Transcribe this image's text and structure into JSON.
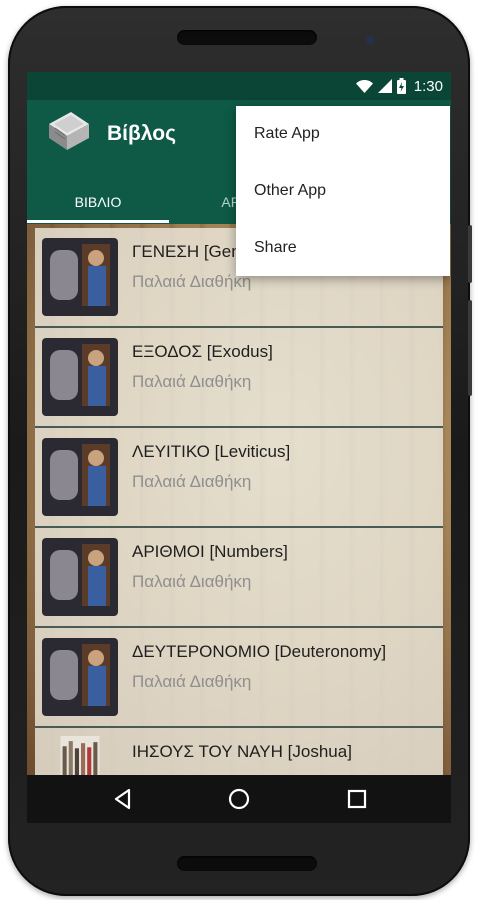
{
  "status": {
    "time": "1:30",
    "icons": [
      "wifi-icon",
      "cell-signal-icon",
      "battery-charging-icon"
    ]
  },
  "appbar": {
    "title": "Βίβλος",
    "logo": "bible-book-icon"
  },
  "tabs": [
    {
      "label": "ΒΙΒΛΙΟ",
      "active": true
    },
    {
      "label": "ΑΡΓΟ",
      "active": false
    }
  ],
  "menu": {
    "items": [
      {
        "label": "Rate App"
      },
      {
        "label": "Other App"
      },
      {
        "label": "Share"
      }
    ]
  },
  "books": [
    {
      "title": "ΓΕΝΕΣΗ [Genesis]",
      "subtitle": "Παλαιά Διαθήκη"
    },
    {
      "title": "ΕΞΟΔΟΣ [Exodus]",
      "subtitle": "Παλαιά Διαθήκη"
    },
    {
      "title": "ΛΕΥΙΤΙΚΟ [Leviticus]",
      "subtitle": "Παλαιά Διαθήκη"
    },
    {
      "title": "ΑΡΙΘΜΟΙ [Numbers]",
      "subtitle": "Παλαιά Διαθήκη"
    },
    {
      "title": "ΔΕΥΤΕΡΟΝΟΜΙΟ [Deuteronomy]",
      "subtitle": "Παλαιά Διαθήκη"
    },
    {
      "title": "ΙΗΣΟΥΣ ΤΟΥ ΝΑΥΗ [Joshua]",
      "subtitle": ""
    }
  ],
  "navbar": {
    "buttons": [
      "back-icon",
      "home-icon",
      "recents-icon"
    ]
  },
  "colors": {
    "primary": "#0e5a46",
    "status_bar": "#0a4536",
    "menu_bg": "#ffffff"
  }
}
